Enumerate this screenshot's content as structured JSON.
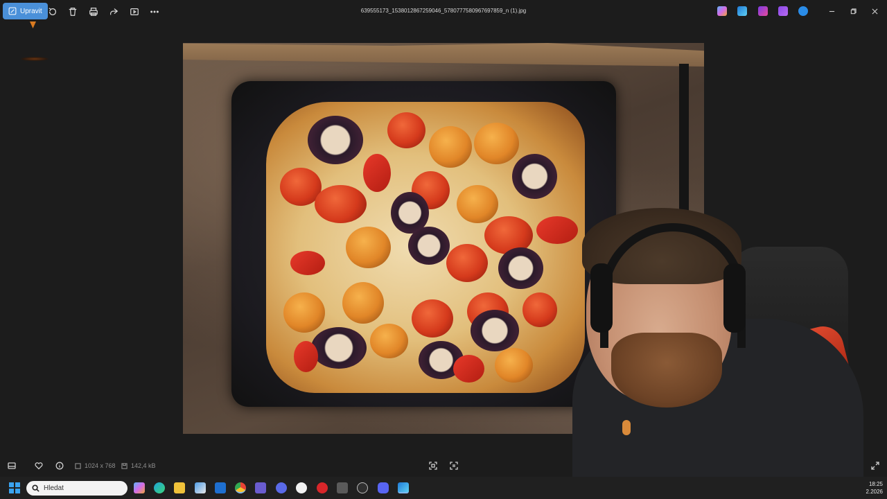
{
  "toolbar": {
    "edit_label": "Upravit",
    "file_name": "639555173_1538012867259046_5780777580967697859_n (1).jpg"
  },
  "info": {
    "dimensions": "1024 x 768",
    "file_size": "142,4 kB"
  },
  "taskbar": {
    "search_placeholder": "Hledat",
    "time": "18:25",
    "date": "2.2026"
  },
  "icons": {
    "edit": "edit-icon",
    "rotate": "rotate-icon",
    "delete": "trash-icon",
    "print": "print-icon",
    "share": "share-icon",
    "slideshow": "slideshow-icon",
    "more": "more-icon",
    "filmstrip": "filmstrip-icon",
    "favorite": "heart-icon",
    "info": "info-icon",
    "fit": "fit-screen-icon",
    "actual_size": "actual-size-icon",
    "fullscreen": "fullscreen-icon"
  },
  "colors": {
    "accent": "#4a90d9",
    "background": "#1c1c1c",
    "taskbar": "#202020"
  }
}
